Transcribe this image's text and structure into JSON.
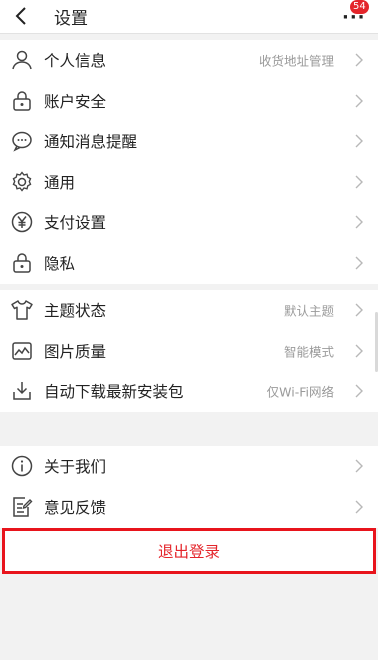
{
  "header": {
    "title": "设置",
    "badge_count": "54"
  },
  "group1": [
    {
      "name": "personal-info",
      "icon": "person-icon",
      "label": "个人信息",
      "value": "收货地址管理"
    },
    {
      "name": "account-security",
      "icon": "lock-icon",
      "label": "账户安全",
      "value": ""
    },
    {
      "name": "notifications",
      "icon": "chat-bubble-icon",
      "label": "通知消息提醒",
      "value": ""
    },
    {
      "name": "general",
      "icon": "gear-icon",
      "label": "通用",
      "value": ""
    },
    {
      "name": "payment-settings",
      "icon": "yen-icon",
      "label": "支付设置",
      "value": ""
    },
    {
      "name": "privacy",
      "icon": "lock-icon",
      "label": "隐私",
      "value": ""
    }
  ],
  "group2": [
    {
      "name": "theme",
      "icon": "shirt-icon",
      "label": "主题状态",
      "value": "默认主题"
    },
    {
      "name": "image-quality",
      "icon": "image-icon",
      "label": "图片质量",
      "value": "智能模式"
    },
    {
      "name": "auto-download",
      "icon": "download-icon",
      "label": "自动下载最新安装包",
      "value": "仅Wi-Fi网络"
    }
  ],
  "group3": [
    {
      "name": "about-us",
      "icon": "info-icon",
      "label": "关于我们",
      "value": ""
    },
    {
      "name": "feedback",
      "icon": "edit-note-icon",
      "label": "意见反馈",
      "value": ""
    }
  ],
  "logout": {
    "label": "退出登录"
  }
}
